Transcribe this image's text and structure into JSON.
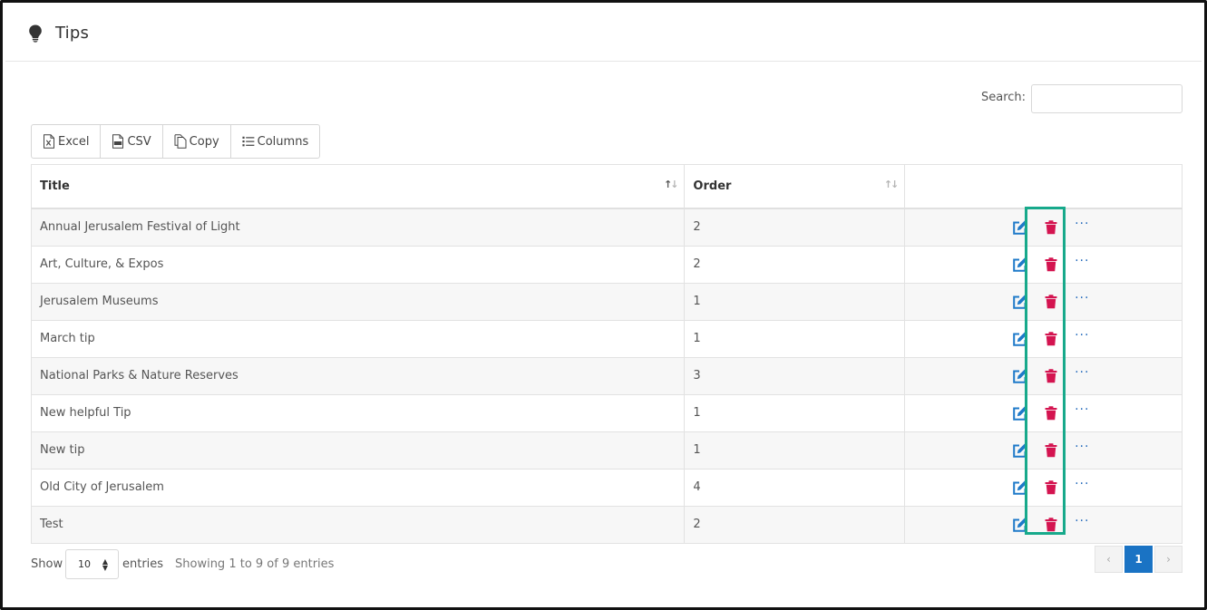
{
  "header": {
    "title": "Tips",
    "icon": "lightbulb-icon"
  },
  "search": {
    "label": "Search:",
    "value": "",
    "placeholder": ""
  },
  "toolbar": {
    "excel": "Excel",
    "csv": "CSV",
    "copy": "Copy",
    "columns": "Columns"
  },
  "table": {
    "columns": [
      "Title",
      "Order",
      ""
    ],
    "rows": [
      {
        "title": "Annual Jerusalem Festival of Light",
        "order": "2"
      },
      {
        "title": "Art, Culture, & Expos",
        "order": "2"
      },
      {
        "title": "Jerusalem Museums",
        "order": "1"
      },
      {
        "title": "March tip",
        "order": "1"
      },
      {
        "title": "National Parks & Nature Reserves",
        "order": "3"
      },
      {
        "title": "New helpful Tip",
        "order": "1"
      },
      {
        "title": "New tip",
        "order": "1"
      },
      {
        "title": "Old City of Jerusalem",
        "order": "4"
      },
      {
        "title": "Test",
        "order": "2"
      }
    ]
  },
  "footer": {
    "show": "Show",
    "page_length": "10",
    "entries": "entries",
    "info": "Showing 1 to 9 of 9 entries",
    "current_page": "1"
  },
  "colors": {
    "edit": "#1f7ac9",
    "delete": "#d41450",
    "highlight": "#17a98b",
    "accent": "#1a73c4"
  }
}
